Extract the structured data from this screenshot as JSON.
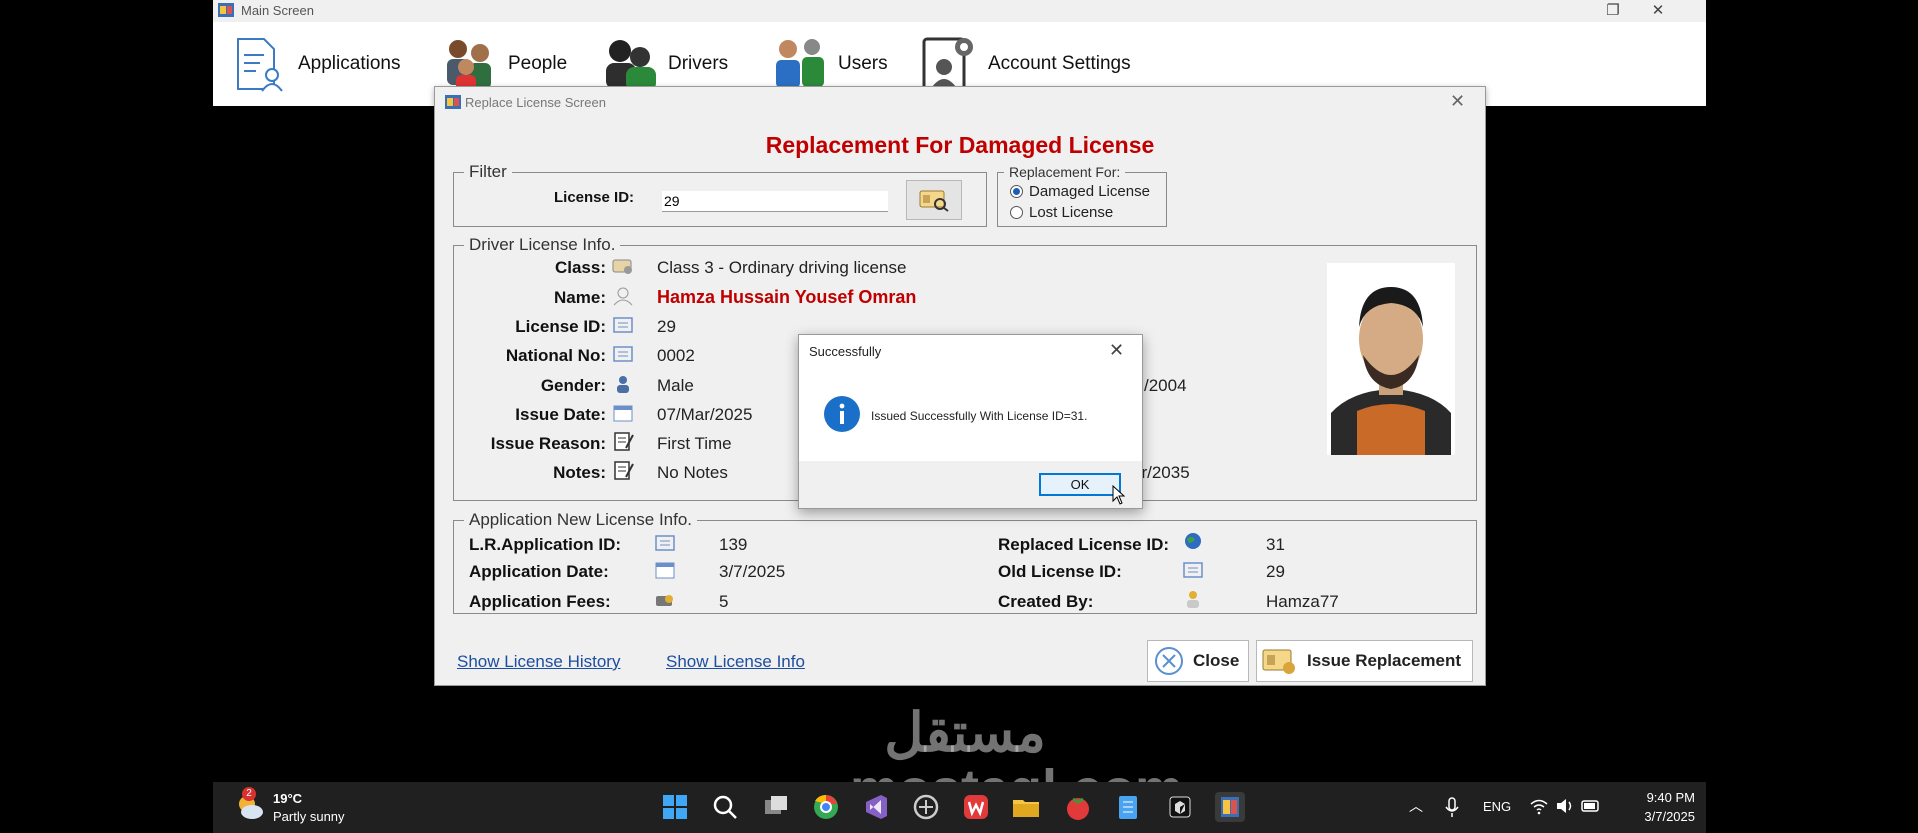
{
  "main_window": {
    "title": "Main Screen",
    "menu": [
      {
        "label": "Applications",
        "icon": "applications-icon"
      },
      {
        "label": "People",
        "icon": "people-icon"
      },
      {
        "label": "Drivers",
        "icon": "drivers-icon"
      },
      {
        "label": "Users",
        "icon": "users-icon"
      },
      {
        "label": "Account Settings",
        "icon": "account-settings-icon"
      }
    ]
  },
  "dialog": {
    "title": "Replace License Screen",
    "heading": "Replacement For Damaged License",
    "filter": {
      "legend": "Filter",
      "license_id_label": "License ID:",
      "license_id_value": "29"
    },
    "replacement_for": {
      "legend": "Replacement For:",
      "options": [
        {
          "label": "Damaged License",
          "selected": true
        },
        {
          "label": "Lost License",
          "selected": false
        }
      ]
    },
    "driver_info": {
      "legend": "Driver License Info.",
      "fields": [
        {
          "label": "Class:",
          "value": "Class 3 - Ordinary driving license"
        },
        {
          "label": "Name:",
          "value": "Hamza Hussain  Yousef Omran"
        },
        {
          "label": "License ID:",
          "value": "29"
        },
        {
          "label": "National No:",
          "value": "0002"
        },
        {
          "label": "Gender:",
          "value": "Male"
        },
        {
          "label": "Issue Date:",
          "value": "07/Mar/2025"
        },
        {
          "label": "Issue Reason:",
          "value": "First Time"
        },
        {
          "label": "Notes:",
          "value": "No Notes"
        }
      ],
      "partial_right_values": [
        "/2004",
        "ar/2035"
      ]
    },
    "application_info": {
      "legend": "Application New License Info.",
      "left": [
        {
          "label": "L.R.Application ID:",
          "value": "139"
        },
        {
          "label": "Application Date:",
          "value": "3/7/2025"
        },
        {
          "label": "Application Fees:",
          "value": "5"
        }
      ],
      "right": [
        {
          "label": "Replaced License ID:",
          "value": "31"
        },
        {
          "label": "Old License ID:",
          "value": "29"
        },
        {
          "label": "Created By:",
          "value": "Hamza77"
        }
      ]
    },
    "links": {
      "history": "Show License History",
      "info": "Show License Info"
    },
    "buttons": {
      "close": "Close",
      "issue": "Issue Replacement"
    }
  },
  "message_box": {
    "title": "Successfully",
    "text": "Issued Successfully With License ID=31.",
    "ok": "OK"
  },
  "taskbar": {
    "weather_temp": "19°C",
    "weather_desc": "Partly sunny",
    "weather_badge": "2",
    "language": "ENG",
    "time": "9:40 PM",
    "date": "3/7/2025"
  },
  "watermark": "مستقل mostaql.com"
}
